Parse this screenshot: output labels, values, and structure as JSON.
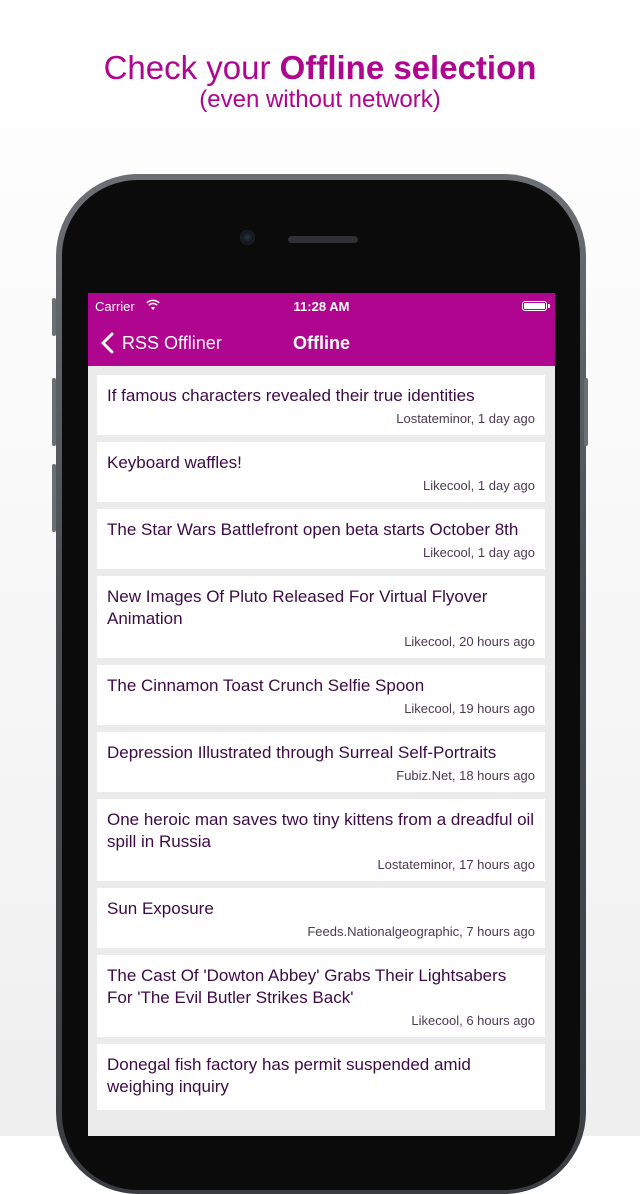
{
  "promo": {
    "headline_pre": "Check your ",
    "headline_bold": "Offline selection",
    "subline": "(even without network)"
  },
  "status_bar": {
    "carrier": "Carrier",
    "time": "11:28 AM"
  },
  "nav": {
    "back_label": "RSS Offliner",
    "title": "Offline"
  },
  "colors": {
    "accent": "#b0058f",
    "title_text": "#3d0a47"
  },
  "articles": [
    {
      "title": "If famous characters revealed their true identities",
      "meta": "Lostateminor, 1 day ago"
    },
    {
      "title": "Keyboard waffles!",
      "meta": "Likecool, 1 day ago"
    },
    {
      "title": "The Star Wars Battlefront open beta starts October 8th",
      "meta": "Likecool, 1 day ago"
    },
    {
      "title": "New Images Of Pluto Released For Virtual Flyover Animation",
      "meta": "Likecool, 20 hours ago"
    },
    {
      "title": "The Cinnamon Toast Crunch Selfie Spoon",
      "meta": "Likecool, 19 hours ago"
    },
    {
      "title": "Depression Illustrated through Surreal Self-Portraits",
      "meta": "Fubiz.Net, 18 hours ago"
    },
    {
      "title": "One heroic man saves two tiny kittens from a dreadful oil spill in Russia",
      "meta": "Lostateminor, 17 hours ago"
    },
    {
      "title": "Sun Exposure",
      "meta": "Feeds.Nationalgeographic, 7 hours ago"
    },
    {
      "title": "The Cast Of 'Dowton Abbey' Grabs Their Lightsabers For 'The Evil Butler Strikes Back'",
      "meta": "Likecool, 6 hours ago"
    },
    {
      "title": "Donegal fish factory has permit suspended amid weighing inquiry",
      "meta": ""
    }
  ]
}
